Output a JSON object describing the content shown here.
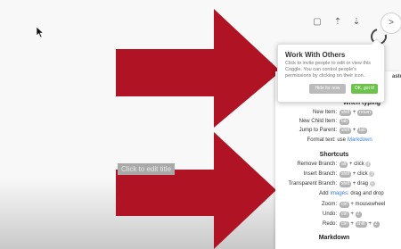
{
  "canvas": {
    "edit_title": "Click to edit title"
  },
  "toolbar": {
    "more_label": ">",
    "icons": [
      "present-icon",
      "share-icon",
      "download-icon"
    ]
  },
  "popup": {
    "title": "Work With Others",
    "body": "Click to invite people to edit or view this Coggle. You can control people's permissions by clicking on their icon.",
    "hide_label": "Hide for now",
    "got_label": "OK, got it!"
  },
  "panel": {
    "paste_label": "aste",
    "when_typing": {
      "title": "When typing",
      "new_item": {
        "label": "New Item:",
        "keys": [
          "shift",
          "return"
        ]
      },
      "new_child": {
        "label": "New Child Item:",
        "keys": [
          "tab"
        ]
      },
      "jump_parent": {
        "label": "Jump to Parent:",
        "keys": [
          "shift",
          "tab"
        ]
      },
      "format_text": {
        "label": "Format text: use",
        "link": "Markdown"
      }
    },
    "shortcuts": {
      "title": "Shortcuts",
      "remove_branch": {
        "label": "Remove Branch:",
        "key": "alt",
        "suffix": "+ click"
      },
      "insert_branch": {
        "label": "Insert Branch:",
        "key": "shift",
        "suffix": "+ click"
      },
      "transparent_branch": {
        "label": "Transparent Branch:",
        "key": "shift",
        "suffix": "+ drag"
      },
      "add_images": {
        "prefix": "Add",
        "link": "Images",
        "suffix": ": drag and drop"
      },
      "zoom": {
        "label": "Zoom:",
        "key": "ctrl",
        "suffix": "+ mousewheel"
      },
      "undo": {
        "label": "Undo:",
        "keys": [
          "ctrl",
          "Z"
        ]
      },
      "redo": {
        "label": "Redo:",
        "keys": [
          "ctrl",
          "shift",
          "Z"
        ]
      }
    },
    "markdown_title": "Markdown"
  },
  "colors": {
    "arrow": "#b01323",
    "accent_green": "#6cc24a",
    "link_blue": "#3d7ee0",
    "key_gray": "#b3b3b3"
  }
}
